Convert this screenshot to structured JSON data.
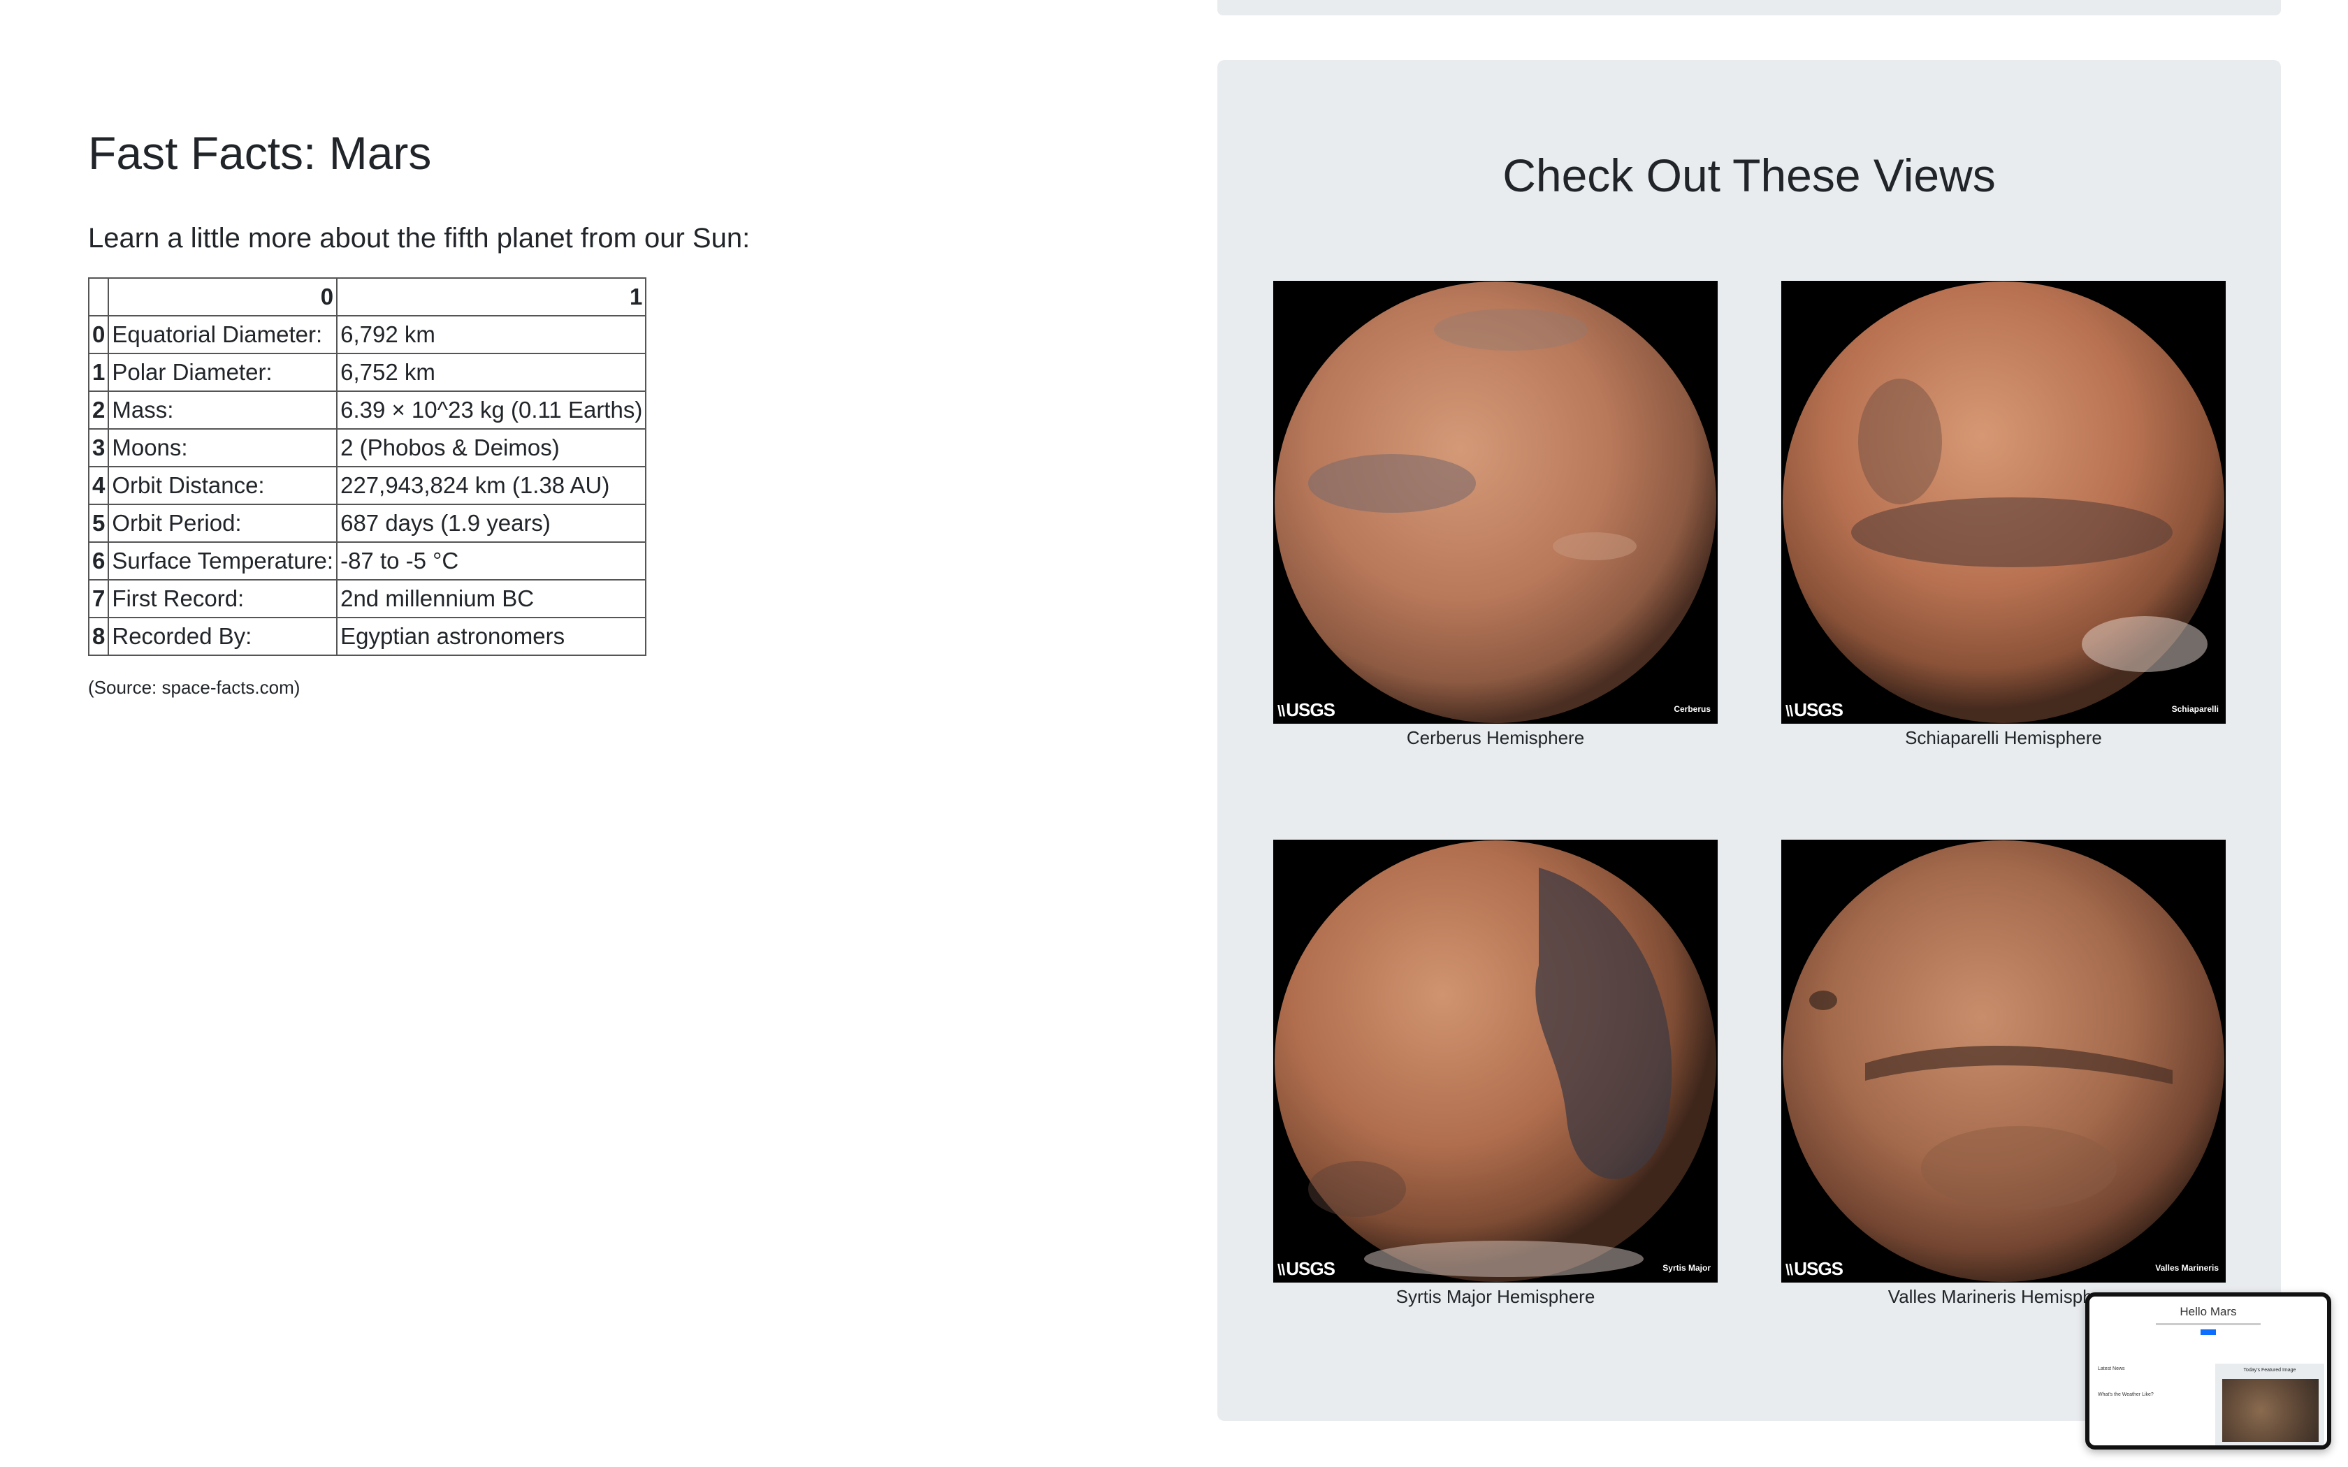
{
  "facts": {
    "title": "Fast Facts: Mars",
    "lead": "Learn a little more about the fifth planet from our Sun:",
    "table": {
      "col_headers": [
        "",
        "0",
        "1"
      ],
      "rows": [
        {
          "idx": "0",
          "label": "Equatorial Diameter:",
          "value": "6,792 km"
        },
        {
          "idx": "1",
          "label": "Polar Diameter:",
          "value": "6,752 km"
        },
        {
          "idx": "2",
          "label": "Mass:",
          "value": "6.39 × 10^23 kg (0.11 Earths)"
        },
        {
          "idx": "3",
          "label": "Moons:",
          "value": "2 (Phobos & Deimos)"
        },
        {
          "idx": "4",
          "label": "Orbit Distance:",
          "value": "227,943,824 km (1.38 AU)"
        },
        {
          "idx": "5",
          "label": "Orbit Period:",
          "value": "687 days (1.9 years)"
        },
        {
          "idx": "6",
          "label": "Surface Temperature:",
          "value": "-87 to -5 °C"
        },
        {
          "idx": "7",
          "label": "First Record:",
          "value": "2nd millennium BC"
        },
        {
          "idx": "8",
          "label": "Recorded By:",
          "value": "Egyptian astronomers"
        }
      ]
    },
    "source": "(Source: space-facts.com)"
  },
  "views": {
    "title": "Check Out These Views",
    "hemispheres": [
      {
        "caption": "Cerberus Hemisphere",
        "image_label": "Cerberus",
        "logo": "USGS"
      },
      {
        "caption": "Schiaparelli Hemisphere",
        "image_label": "Schiaparelli",
        "logo": "USGS"
      },
      {
        "caption": "Syrtis Major Hemisphere",
        "image_label": "Syrtis Major",
        "logo": "USGS"
      },
      {
        "caption": "Valles Marineris Hemisphere",
        "image_label": "Valles Marineris",
        "logo": "USGS"
      }
    ]
  },
  "mini_preview": {
    "title": "Hello Mars",
    "latest_news": "Latest News",
    "featured": "Today's Featured Image",
    "weather": "What's the Weather Like?"
  },
  "colors": {
    "panel_bg": "#e9ecef",
    "text": "#212529",
    "button": "#0d6efd"
  }
}
